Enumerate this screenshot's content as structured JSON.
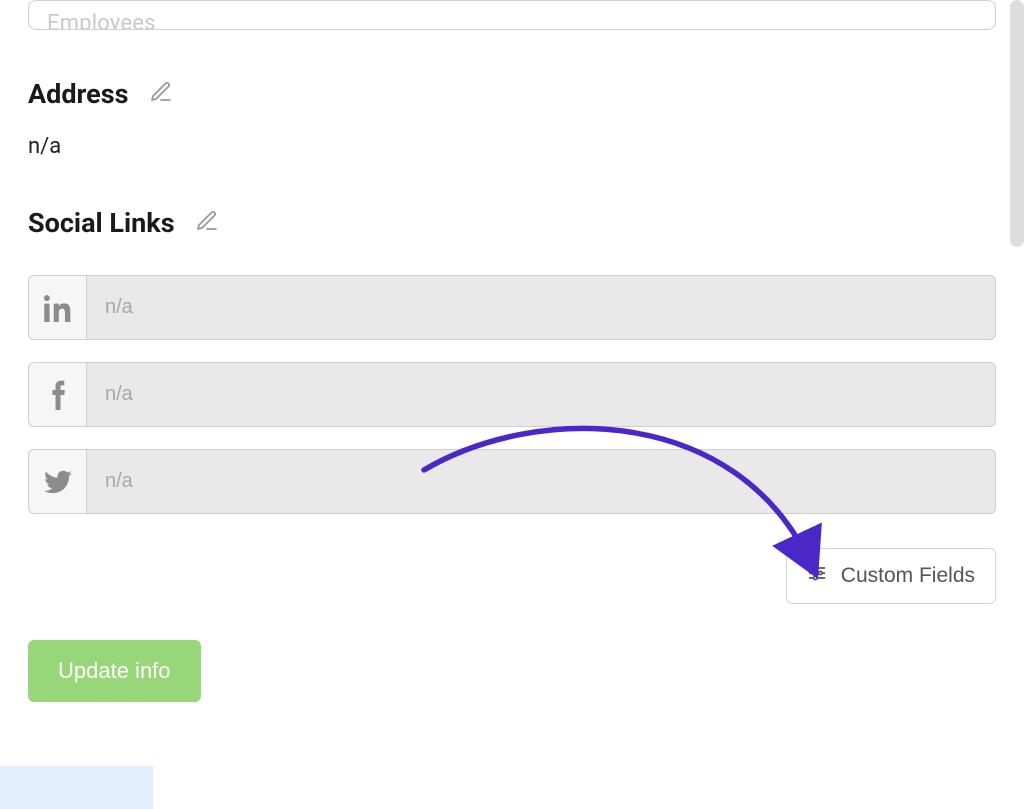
{
  "employees_input": {
    "placeholder": "Employees"
  },
  "sections": {
    "address": {
      "heading": "Address",
      "value": "n/a"
    },
    "social": {
      "heading": "Social Links"
    }
  },
  "social_rows": {
    "linkedin": {
      "placeholder": "n/a"
    },
    "facebook": {
      "placeholder": "n/a"
    },
    "twitter": {
      "placeholder": "n/a"
    }
  },
  "buttons": {
    "custom_fields": "Custom Fields",
    "update_info": "Update info"
  },
  "colors": {
    "annotation_arrow": "#4b27c7",
    "primary_action_bg": "#98d779"
  }
}
